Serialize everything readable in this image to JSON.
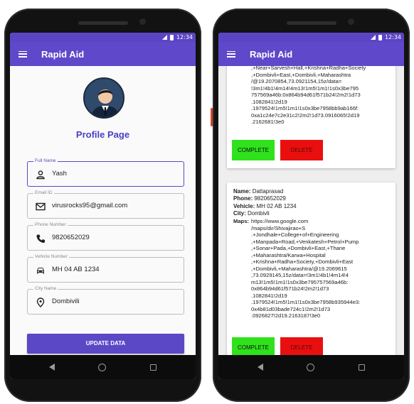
{
  "status_bar": {
    "time": "12:34"
  },
  "app": {
    "title": "Rapid Aid"
  },
  "profile": {
    "title": "Profile Page",
    "fields": {
      "full_name": {
        "label": "Full Name",
        "value": "Yash",
        "icon": "person-icon"
      },
      "email": {
        "label": "Email ID",
        "value": "virusrocks95@gmail.com",
        "icon": "mail-icon"
      },
      "phone": {
        "label": "Phone Number",
        "value": "9820652029",
        "icon": "phone-icon"
      },
      "vehicle": {
        "label": "Vehicle Number",
        "value": "MH 04 AB 1234",
        "icon": "car-icon"
      },
      "city": {
        "label": "City Name",
        "value": "Dombivili",
        "icon": "location-pin-icon"
      }
    },
    "update_button": "UPDATE DATA",
    "colors": {
      "primary": "#5b48c6",
      "appbar": "#5f48c9"
    }
  },
  "requests": {
    "card1": {
      "maps_tail": ",+Near+Sarvesh+Hall,+Krishna+Radha+Society\n,+Dombivli+East,+Dombivli,+Maharashtra\n/@19.2070854,73.0921154,15z/data=\n!3m1!4b1!4m14!4m13!1m5!1m1!1s0x3be795\n757569a46b:0x864b94d61f571b24!2m2!1d73\n.1082841!2d19\n.1979524!1m5!1m1!1s0x3be7958bb9ab166f:\n0xa1c24e7c2e31c2!2m2!1d73.0916065!2d19\n.2162681!3e0",
      "complete_label": "COMPLETE",
      "delete_label": "DELETE"
    },
    "card2": {
      "labels": {
        "name": "Name:",
        "phone": "Phone:",
        "vehicle": "Vehicle:",
        "city": "City:",
        "maps": "Maps:"
      },
      "name": "Dattaprasad",
      "phone": "9820652029",
      "vehicle": "MH 02 AB 1234",
      "city": "Dombivli",
      "maps": "https://www.google.com\n/maps/dir/Shivajirao+S\n.+Jondhale+College+of+Engineering\n,+Manpada+Road,+Venkatesh+Petrol+Pump\n,+Sonar+Pada,+Dombivli+East,+Thane\n,+Maharashtra/Karwa+Hospital\n,+Krishna+Radha+Society,+Dombivli+East\n,+Dombivli,+Maharashtra/@19.2069615\n,73.0929145,15z/data=!3m1!4b1!4m14!4\nm13!1m5!1m1!1s0x3be795757569a46b:\n0x864b94d61f571b24!2m2!1d73\n.1082841!2d19\n.1979524!1m5!1m1!1s0x3be7958b935944e3:\n0x4b81d03bade724c1!2m2!1d73\n.0926827!2d19.2163187!3e0",
      "complete_label": "COMPLETE",
      "delete_label": "DELETE"
    },
    "colors": {
      "complete": "#2fe21c",
      "delete": "#ea0f0f"
    }
  }
}
